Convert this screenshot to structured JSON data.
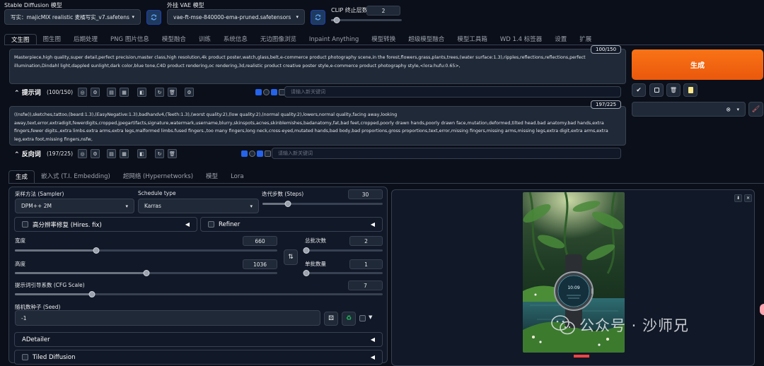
{
  "top": {
    "model_label": "Stable Diffusion 模型",
    "model_value": "写实：majicMIX realistic 麦橘写实_v7.safetens",
    "vae_label": "外挂 VAE 模型",
    "vae_value": "vae-ft-mse-840000-ema-pruned.safetensors",
    "clip_label": "CLIP 终止层数",
    "clip_value": "2"
  },
  "main_tabs": [
    "文生图",
    "图生图",
    "后期处理",
    "PNG 图片信息",
    "模型融合",
    "训练",
    "系统信息",
    "无边图像浏览",
    "Inpaint Anything",
    "模型转换",
    "超级模型融合",
    "模型工具箱",
    "WD 1.4 标签器",
    "设置",
    "扩展"
  ],
  "prompt": {
    "text": "Masterpiece,high quality,super detail,perfect precision,master class,high resolution,4k product poster,watch,glass,belt,e-commerce product photography scene,in the forest,flowers,grass,plants,trees,(water surface:1.3),ripples,reflections,reflections,perfect illumination,Dindahl light,dappled sunlight,dark color,blue tone,C4D product rendering,oc rendering,3d,realistic product creative poster style,e-commerce product photography style,<lora:hufu:0.65>,",
    "counter": "100/150",
    "label": "提示词",
    "count": "(100/150)",
    "keyword_placeholder": "请输入新关键词"
  },
  "negative": {
    "text": "((nsfw)),sketches,tattoo,(beard:1.3),(EasyNegative:1.3),badhandv4,(Teeth:1.3),(worst quality:2),(low quality:2),(normal quality:2),lowers,normal quality,facing away,looking away,text,error,extradigit,fewerdigits,cropped,jpegartifacts,signature,watermark,username,blurry,skinspots,acnes,skinblemishes,badanatomy,fat,bad feet,cropped,poorly drawn hands,poorly drawn face,mutation,deformed,tilted head.bad anatomy.bad hands,extra fingers,fewer digits.,extra limbs.extra arms,extra legs,malformed limbs.fused fingers.,too many fingers,long neck,cross-eyed,mutated hands,bad body,bad proportions,gross proportions,text,error,missing fingers,missing arms,missing legs,extra digit,extra arms,extra leg,extra foot,missing fingers,nsfw,",
    "counter": "197/225",
    "label": "反向词",
    "count": "(197/225)",
    "keyword_placeholder": "请输入新关键词"
  },
  "generate_label": "生成",
  "sub_tabs": [
    "生成",
    "嵌入式 (T.I. Embedding)",
    "超网络 (Hypernetworks)",
    "模型",
    "Lora"
  ],
  "params": {
    "sampler_label": "采样方法 (Sampler)",
    "sampler_value": "DPM++ 2M",
    "schedule_label": "Schedule type",
    "schedule_value": "Karras",
    "steps_label": "迭代步数 (Steps)",
    "steps_value": "30",
    "hires_label": "高分辨率修复 (Hires. fix)",
    "refiner_label": "Refiner",
    "width_label": "宽度",
    "width_value": "660",
    "height_label": "高度",
    "height_value": "1036",
    "batch_count_label": "总批次数",
    "batch_count_value": "2",
    "batch_size_label": "单批数量",
    "batch_size_value": "1",
    "cfg_label": "提示词引导系数 (CFG Scale)",
    "cfg_value": "7",
    "seed_label": "随机数种子 (Seed)",
    "seed_value": "-1",
    "adetailer_label": "ADetailer",
    "tiled_label": "Tiled Diffusion"
  },
  "watermark": "公众号 · 沙师兄",
  "colors": {
    "accent": "#f97316",
    "background": "#0b0f19",
    "panel": "#111827",
    "input": "#1f2937"
  }
}
